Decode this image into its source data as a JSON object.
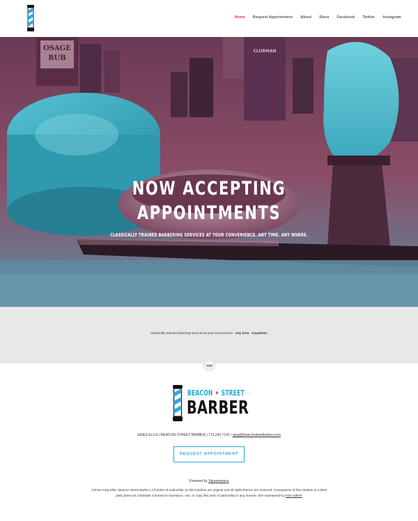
{
  "header": {
    "nav": [
      {
        "label": "Home",
        "active": true
      },
      {
        "label": "Request Appointment",
        "active": false
      },
      {
        "label": "About",
        "active": false
      },
      {
        "label": "Store",
        "active": false
      },
      {
        "label": "Facebook",
        "active": false
      },
      {
        "label": "Twitter",
        "active": false
      },
      {
        "label": "Instagram",
        "active": false
      }
    ]
  },
  "hero": {
    "title_line1": "NOW ACCEPTING",
    "title_line2": "APPOINTMENTS",
    "subtitle": "CLASSICALLY TRAINED BARBERING SERVICES AT YOUR CONVENIENCE. ANY TIME. ANY WHERE.",
    "label_osage_top": "OSAGE",
    "label_osage_bottom": "RUB",
    "label_clubman": "CLUBMAN"
  },
  "band": {
    "text": "Classically trained barbering services at your convenience.",
    "bold1": "Any time.",
    "bold2": "Anywhere."
  },
  "top_button": "TOP",
  "footer": {
    "brand_word1": "BEACON",
    "brand_star": "✶",
    "brand_word2": "STREET",
    "brand_word3": "BARBER",
    "contact_text": "GREG ELLIS / BEACON STREET BARBER | 773.242.7141 |",
    "contact_email": "greg@beaconstreetbarber.com",
    "cta": "REQUEST APPOINTMENT",
    "powered_by": "Powered by",
    "powered_link": "Squarespace",
    "copyright_line1": "©2016 Greg Ellis / Beacon Street Barber | All works of authorship on this medium are original and all rights thereto are reserved. Conveyance of this",
    "copyright_line2": "medium to a third party does not constitute a license to reproduce, use, or copy this work of authorship in any manner. Site maintained by",
    "maintainer": "Nick Volkert"
  },
  "colors": {
    "accent_red": "#d9322c",
    "accent_blue": "#2fa9dd",
    "hero_magenta": "#8a4d66",
    "hero_cyan": "#3fb6c9"
  }
}
